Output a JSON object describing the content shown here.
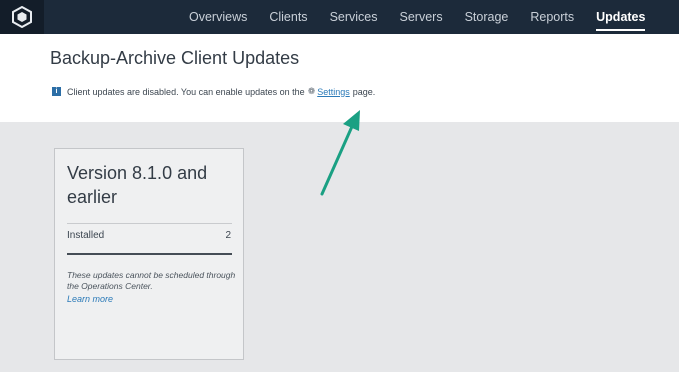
{
  "nav": {
    "items": [
      {
        "label": "Overviews"
      },
      {
        "label": "Clients"
      },
      {
        "label": "Services"
      },
      {
        "label": "Servers"
      },
      {
        "label": "Storage"
      },
      {
        "label": "Reports"
      },
      {
        "label": "Updates"
      }
    ],
    "active": "Updates"
  },
  "page": {
    "title": "Backup-Archive Client Updates"
  },
  "notice": {
    "icon": "info-icon",
    "text_before": "Client updates are disabled. You can enable updates on the",
    "settings_icon": "gear-icon",
    "link_label": "Settings",
    "text_after": "page."
  },
  "card": {
    "title": "Version 8.1.0 and earlier",
    "installed_label": "Installed",
    "installed_count": "2",
    "note": "These updates cannot be scheduled through the Operations Center.",
    "learn_more": "Learn more"
  },
  "colors": {
    "topbar": "#1c2a3a",
    "accent_link": "#2b7ab8",
    "annotation_arrow": "#1aa083"
  }
}
